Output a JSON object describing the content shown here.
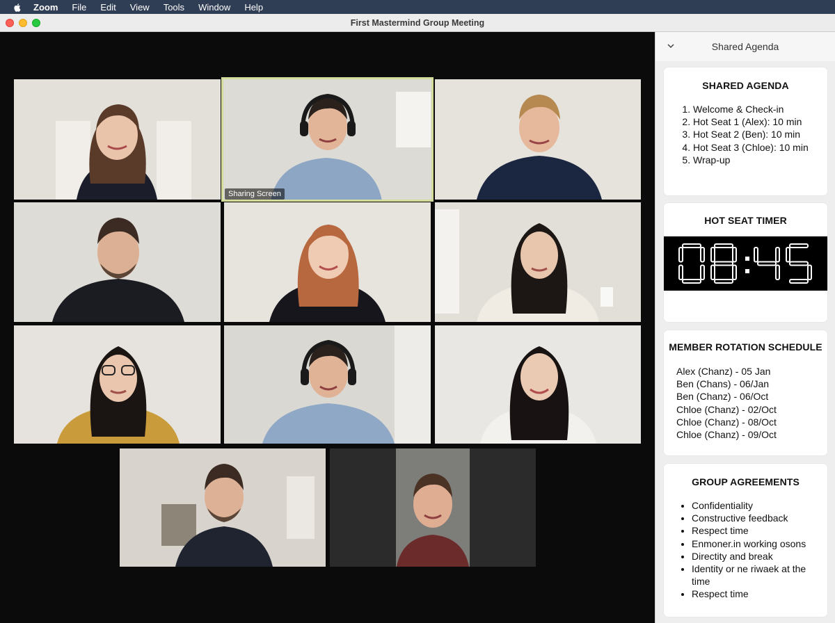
{
  "menubar": {
    "app_name": "Zoom",
    "items": [
      "File",
      "Edit",
      "View",
      "Tools",
      "Window",
      "Help"
    ]
  },
  "window": {
    "title": "First Mastermind Group Meeting"
  },
  "video": {
    "active_label": "Sharing Screen"
  },
  "panel": {
    "header_title": "Shared Agenda",
    "agenda": {
      "title": "SHARED AGENDA",
      "items": [
        "Welcome & Check-in",
        "Hot Seat 1 (Alex): 10 min",
        "Hot Seat 2 (Ben): 10 min",
        "Hot Seat 3 (Chloe): 10 min",
        "Wrap-up"
      ]
    },
    "timer": {
      "title": "HOT SEAT TIMER",
      "value": "08:45"
    },
    "rotation": {
      "title": "MEMBER ROTATION SCHEDULE",
      "items": [
        "Alex (Chanz) - 05 Jan",
        "Ben (Chans) - 06/Jan",
        "Ben (Chanz) - 06/Oct",
        "Chloe (Chanz) - 02/Oct",
        "Chloe (Chanz) - 08/Oct",
        "Chloe (Chanz) - 09/Oct"
      ]
    },
    "agreements": {
      "title": "GROUP AGREEMENTS",
      "items": [
        "Confidentiality",
        "Constructive feedback",
        "Respect time",
        "Enmoner.in working osons",
        "Directity and break",
        "Identity or ne riwaek at the time",
        "Respect time"
      ]
    }
  },
  "colors": {
    "menubar": "#2f3d55",
    "active_speaker_border": "#d4dc9a",
    "timer_bg": "#000000",
    "timer_digits": "#ffffff"
  }
}
